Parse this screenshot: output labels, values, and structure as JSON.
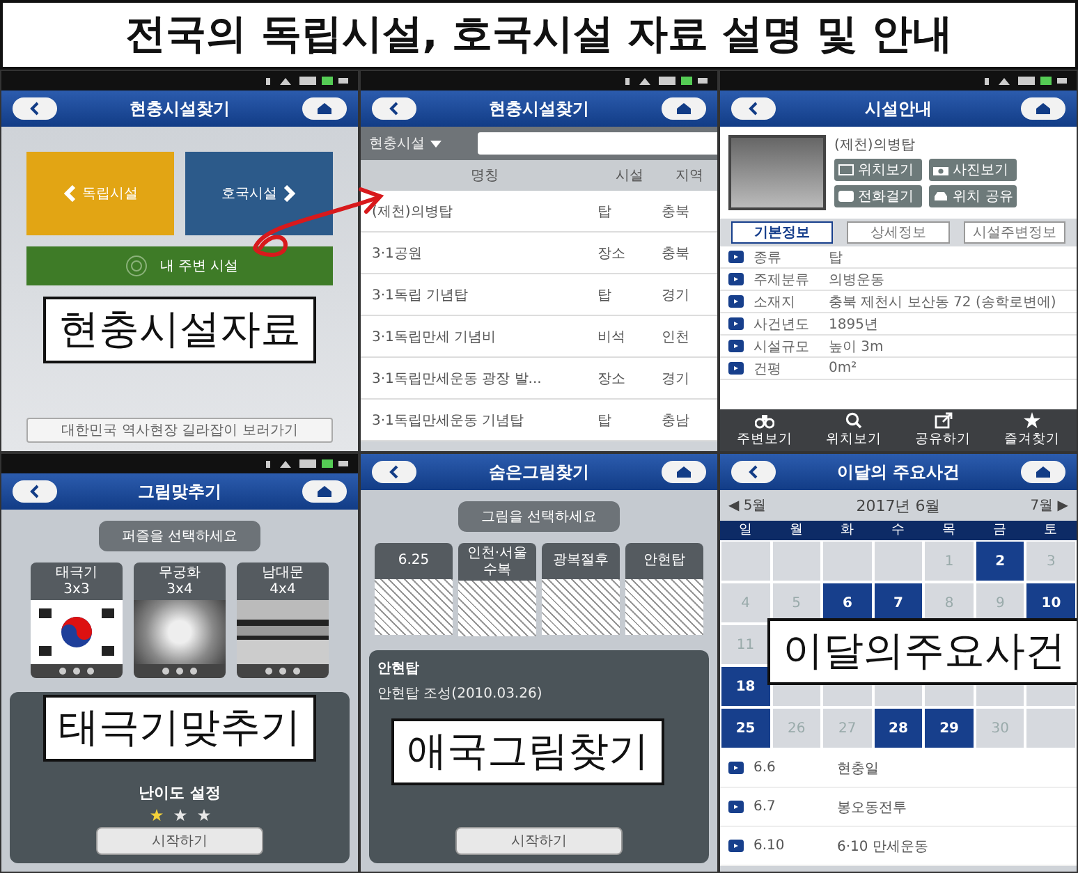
{
  "title": "전국의 독립시설, 호국시설 자료 설명 및 안내",
  "screens": [
    {
      "kind": "menu",
      "header": "현충시설찾기",
      "tiles": [
        {
          "label": "독립시설",
          "color": "#e2a514"
        },
        {
          "label": "호국시설",
          "color": "#2c5a8a"
        },
        {
          "label": "내 주변 시설",
          "color": "#3e7b27"
        }
      ],
      "footer": "대한민국 역사현장 길라잡이 보러가기",
      "caption": "현충시설자료"
    },
    {
      "kind": "list",
      "header": "현충시설찾기",
      "filter": "현충시설",
      "columns": [
        "명칭",
        "시설",
        "지역"
      ],
      "rows": [
        [
          "(제천)의병탑",
          "탑",
          "충북"
        ],
        [
          "3·1공원",
          "장소",
          "충북"
        ],
        [
          "3·1독립 기념탑",
          "탑",
          "경기"
        ],
        [
          "3·1독립만세 기념비",
          "비석",
          "인천"
        ],
        [
          "3·1독립만세운동 광장 발...",
          "장소",
          "경기"
        ],
        [
          "3·1독립만세운동 기념탑",
          "탑",
          "충남"
        ]
      ]
    },
    {
      "kind": "detail",
      "header": "시설안내",
      "name": "(제천)의병탑",
      "actions": [
        "위치보기",
        "사진보기",
        "전화걸기",
        "위치 공유"
      ],
      "tabs": [
        {
          "label": "기본정보",
          "selected": true
        },
        {
          "label": "상세정보",
          "selected": false
        },
        {
          "label": "시설주변정보",
          "selected": false
        }
      ],
      "fields": [
        {
          "label": "종류",
          "value": "탑"
        },
        {
          "label": "주제분류",
          "value": "의병운동"
        },
        {
          "label": "소재지",
          "value": "충북 제천시 보산동 72 (송학로변에)"
        },
        {
          "label": "사건년도",
          "value": "1895년"
        },
        {
          "label": "시설규모",
          "value": "높이 3m"
        },
        {
          "label": "건평",
          "value": "0m²"
        }
      ],
      "toolbar": [
        "주변보기",
        "위치보기",
        "공유하기",
        "즐겨찾기"
      ]
    },
    {
      "kind": "puzzle",
      "header": "그림맞추기",
      "prompt": "퍼즐을 선택하세요",
      "cards": [
        {
          "label": "태극기",
          "size": "3x3"
        },
        {
          "label": "무궁화",
          "size": "3x4"
        },
        {
          "label": "남대문",
          "size": "4x4"
        }
      ],
      "difficulty": "난이도 설정",
      "stars": 1,
      "button": "시작하기",
      "caption": "태극기맞추기"
    },
    {
      "kind": "picture",
      "header": "숨은그림찾기",
      "prompt": "그림을 선택하세요",
      "cards": [
        "6.25",
        "인천·서울 수복",
        "광복절후",
        "안현탑"
      ],
      "info_title": "안현탑",
      "info_text": "안현탑 조성(2010.03.26)",
      "button": "시작하기",
      "caption": "애국그림찾기"
    },
    {
      "kind": "calendar",
      "header": "이달의 주요사건",
      "prev": "◀ 5월",
      "month": "2017년 6월",
      "next": "7월 ▶",
      "weekdays": [
        "일",
        "월",
        "화",
        "수",
        "목",
        "금",
        "토"
      ],
      "weeks": [
        [
          {
            "selected": false
          },
          {
            "selected": false
          },
          {
            "selected": false
          },
          {
            "selected": false
          },
          {
            "day": "1",
            "selected": false
          },
          {
            "day": "2",
            "selected": true
          },
          {
            "day": "3",
            "selected": false
          }
        ],
        [
          {
            "day": "4",
            "selected": false
          },
          {
            "day": "5",
            "selected": false
          },
          {
            "day": "6",
            "selected": true
          },
          {
            "day": "7",
            "selected": true
          },
          {
            "day": "8",
            "selected": false
          },
          {
            "day": "9",
            "selected": false
          },
          {
            "day": "10",
            "selected": true
          }
        ],
        [
          {
            "day": "11",
            "selected": false
          }
        ],
        [
          {
            "day": "18",
            "selected": true
          },
          {
            "selected": false
          },
          {
            "selected": false
          },
          {
            "selected": false
          },
          {
            "selected": false
          },
          {
            "selected": false
          },
          {
            "selected": false
          }
        ],
        [
          {
            "day": "25",
            "selected": true
          },
          {
            "day": "26",
            "selected": false
          },
          {
            "day": "27",
            "selected": false
          },
          {
            "day": "28",
            "selected": true
          },
          {
            "day": "29",
            "selected": true
          },
          {
            "day": "30",
            "selected": false
          },
          {
            "selected": false
          }
        ]
      ],
      "events": [
        {
          "date": "6.6",
          "name": "현충일"
        },
        {
          "date": "6.7",
          "name": "봉오동전투"
        },
        {
          "date": "6.10",
          "name": "6·10 만세운동"
        }
      ],
      "caption": "이달의주요사건"
    }
  ]
}
